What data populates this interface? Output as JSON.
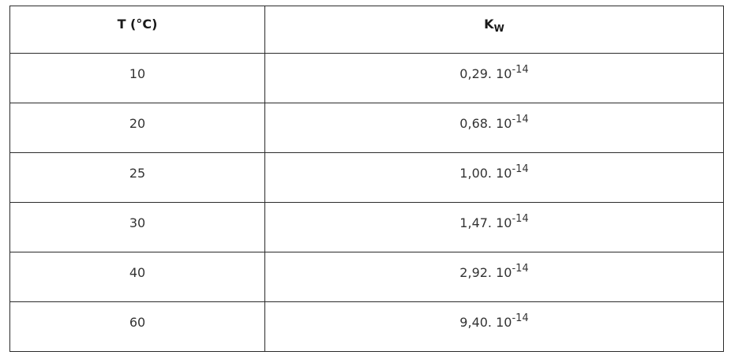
{
  "table": {
    "headers": {
      "temperature": "T (°C)",
      "kw_base": "K",
      "kw_sub": "W"
    },
    "exponent_base": "10",
    "exponent": "-14",
    "rows": [
      {
        "t": "10",
        "coef": "0,29."
      },
      {
        "t": "20",
        "coef": "0,68."
      },
      {
        "t": "25",
        "coef": "1,00."
      },
      {
        "t": "30",
        "coef": "1,47."
      },
      {
        "t": "40",
        "coef": "2,92."
      },
      {
        "t": "60",
        "coef": "9,40."
      }
    ]
  }
}
